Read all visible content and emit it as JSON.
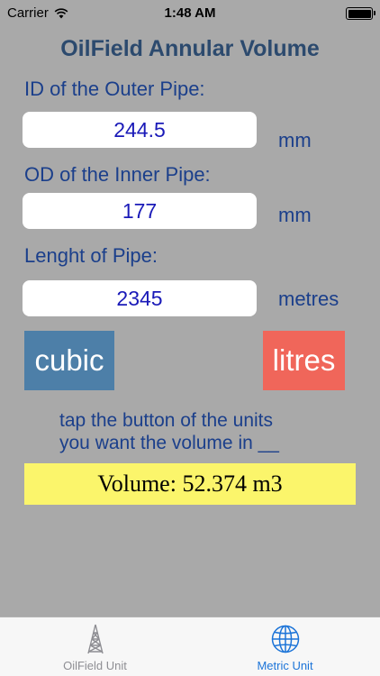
{
  "status_bar": {
    "carrier": "Carrier",
    "time": "1:48 AM"
  },
  "title": "OilField Annular Volume",
  "outer_pipe": {
    "label": "ID of the Outer Pipe:",
    "value": "244.5",
    "unit": "mm"
  },
  "inner_pipe": {
    "label": "OD of the Inner Pipe:",
    "value": "177",
    "unit": "mm"
  },
  "pipe_length": {
    "label": "Lenght of Pipe:",
    "value": "2345",
    "unit": "metres"
  },
  "buttons": {
    "cubic": "cubic",
    "litres": "litres"
  },
  "hint": {
    "line1": "tap the button of the units",
    "line2": "you want the volume in __"
  },
  "result": "Volume: 52.374 m3",
  "tab_bar": {
    "tabs": [
      {
        "label": "OilField Unit",
        "icon": "oil-derrick-icon",
        "selected": false
      },
      {
        "label": "Metric Unit",
        "icon": "globe-icon",
        "selected": true
      }
    ]
  },
  "colors": {
    "background": "#a9a9a9",
    "cubic_button": "#4d7fa8",
    "litres_button": "#f0665a",
    "result_bg": "#fbf56b",
    "tab_active": "#1c74d8"
  }
}
